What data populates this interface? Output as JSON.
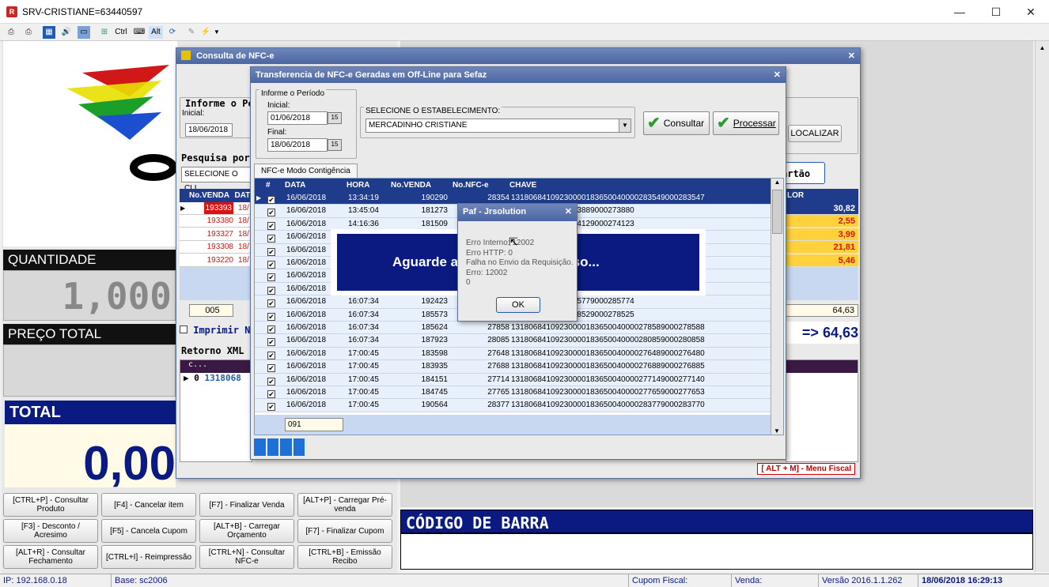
{
  "window": {
    "title": "SRV-CRISTIANE=63440597",
    "min": "—",
    "max": "☐",
    "close": "✕"
  },
  "toolbar": {
    "ctrl": "Ctrl",
    "alt": "Alt"
  },
  "main": {
    "informe": "Informe o Pe",
    "inicial_label": "Inicial:",
    "inicial_value": "18/06/2018",
    "pesquisa": "Pesquisa por",
    "selecione_cli": "SELECIONE O CLI",
    "localizar": "LOCALIZAR",
    "cartao": "artão",
    "vendas_headers": [
      "No.VENDA",
      "DAT"
    ],
    "vendas": [
      {
        "n": "193393",
        "d": "18/"
      },
      {
        "n": "193380",
        "d": "18/"
      },
      {
        "n": "193327",
        "d": "18/"
      },
      {
        "n": "193308",
        "d": "18/"
      },
      {
        "n": "193220",
        "d": "18/"
      }
    ],
    "valor_header": "LOR",
    "valores": [
      "30,82",
      "2,55",
      "3,99",
      "21,81",
      "5,46"
    ],
    "count": "005",
    "sum": "64,63",
    "total_arrow": "=> 64,63",
    "quantidade_label": "QUANTIDADE",
    "quantidade_value": "1,000",
    "preco_label": "PREÇO TOTAL",
    "imprimir": "Imprimir N",
    "retorno": "Retorno XML",
    "xml_row_idx": "0",
    "xml_row_val": "1318068",
    "xml_head": "c..."
  },
  "total": {
    "label": "TOTAL",
    "value": "0,00"
  },
  "fn_buttons": [
    [
      "[CTRL+P] - Consultar Produto",
      "[F4] - Cancelar item",
      "[F7] - Finalizar Venda",
      "[ALT+P] - Carregar Pré-venda"
    ],
    [
      "[F3] - Desconto / Acresimo",
      "[F5] - Cancela Cupom",
      "[ALT+B] - Carregar Orçamento",
      "[F7] - Finalizar Cupom"
    ],
    [
      "[ALT+R] - Consultar Fechamento",
      "[CTRL+I] - Reimpressão",
      "[CTRL+N] - Consultar NFC-e",
      "[CTRL+B] - Emissão Recibo"
    ]
  ],
  "codigo_barra": "CÓDIGO DE BARRA",
  "menu_fiscal": "[ ALT + M] - Menu Fiscal",
  "consulta_dialog": {
    "title": "Consulta de NFC-e",
    "close": "✕"
  },
  "transfer_dialog": {
    "title": "Transferencia de NFC-e Geradas em Off-Line para Sefaz",
    "close": "✕",
    "periodo_legend": "Informe o Período",
    "inicial_label": "Inicial:",
    "inicial": "01/06/2018",
    "final_label": "Final:",
    "final": "18/06/2018",
    "estab_label": "SELECIONE O ESTABELECIMENTO:",
    "estab_value": "MERCADINHO CRISTIANE",
    "consultar": "Consultar",
    "processar": "Processar",
    "tab": "NFC-e Modo Contigência",
    "headers": [
      "#",
      "DATA",
      "HORA",
      "No.VENDA",
      "No.NFC-e",
      "CHAVE"
    ],
    "rows": [
      [
        "16/06/2018",
        "13:34:19",
        "190290",
        "28354",
        "13180684109230000183650040000283549000283547"
      ],
      [
        "16/06/2018",
        "13:45:04",
        "181273",
        "",
        "0183650040000273889000273880"
      ],
      [
        "16/06/2018",
        "14:16:36",
        "181509",
        "",
        "0183650040000274129000274123"
      ],
      [
        "16/06/2018",
        "",
        "",
        "",
        ""
      ],
      [
        "16/06/2018",
        "",
        "",
        "",
        ""
      ],
      [
        "16/06/2018",
        "",
        "",
        "",
        ""
      ],
      [
        "16/06/2018",
        "",
        "",
        "",
        ""
      ],
      [
        "16/06/2018",
        "",
        "",
        "",
        ""
      ],
      [
        "16/06/2018",
        "16:07:34",
        "192423",
        "",
        "0183650040000285779000285774"
      ],
      [
        "16/06/2018",
        "16:07:34",
        "185573",
        "",
        "0183650040000278529000278525"
      ],
      [
        "16/06/2018",
        "16:07:34",
        "185624",
        "27858",
        "13180684109230000183650040000278589000278588"
      ],
      [
        "16/06/2018",
        "16:07:34",
        "187923",
        "28085",
        "13180684109230000183650040000280859000280858"
      ],
      [
        "16/06/2018",
        "17:00:45",
        "183598",
        "27648",
        "13180684109230000183650040000276489000276480"
      ],
      [
        "16/06/2018",
        "17:00:45",
        "183935",
        "27688",
        "13180684109230000183650040000276889000276885"
      ],
      [
        "16/06/2018",
        "17:00:45",
        "184151",
        "27714",
        "13180684109230000183650040000277149000277140"
      ],
      [
        "16/06/2018",
        "17:00:45",
        "184745",
        "27765",
        "13180684109230000183650040000277659000277653"
      ],
      [
        "16/06/2018",
        "17:00:45",
        "190564",
        "28377",
        "13180684109230000183650040000283779000283770"
      ]
    ],
    "footer_count": "091"
  },
  "aguarde": "Aguarde a                     rocesso...",
  "error_dialog": {
    "title": "Paf - Jrsolution",
    "close": "✕",
    "lines": [
      "Erro Interno: 12002",
      "Erro HTTP: 0",
      "Falha no Envio da Requisição.",
      "Erro: 12002",
      "0"
    ],
    "ok": "OK"
  },
  "statusbar": {
    "ip": "IP: 192.168.0.18",
    "base": "Base: sc2006",
    "cupom": "Cupom Fiscal:",
    "venda": "Venda:",
    "versao": "Versão 2016.1.1.262",
    "datetime": "18/06/2018 16:29:13"
  }
}
